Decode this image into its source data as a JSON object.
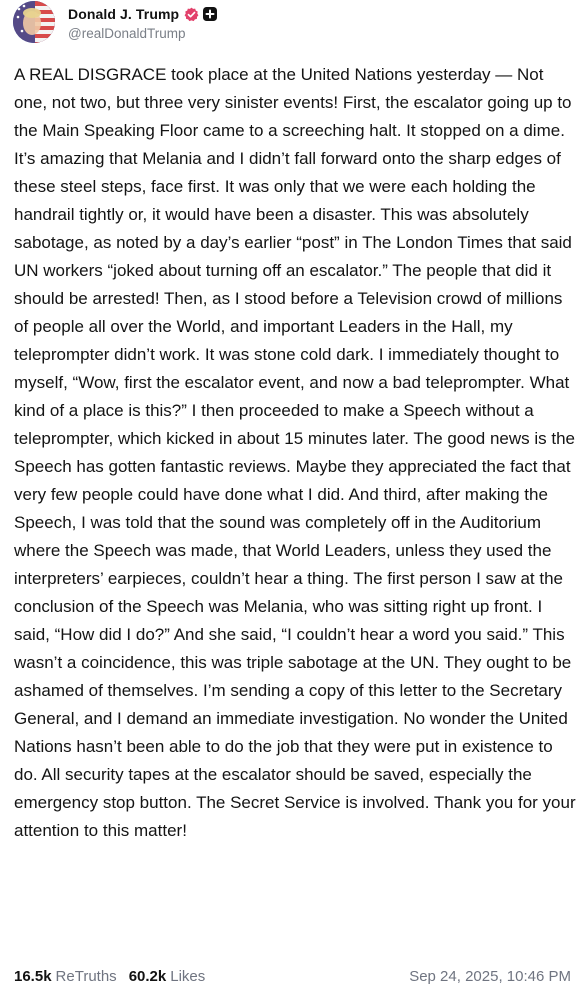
{
  "author": {
    "display_name": "Donald J. Trump",
    "handle": "@realDonaldTrump",
    "verified_icon": "verified-check-icon",
    "plus_icon": "plus-badge-icon",
    "accent_color": "#e2416b"
  },
  "post": {
    "text": "A REAL DISGRACE took place at the United Nations yesterday — Not one, not two, but three very sinister events! First, the escalator going up to the Main Speaking Floor came to a screeching halt. It stopped on a dime. It’s amazing that Melania and I didn’t fall forward onto the sharp edges of these steel steps, face first. It was only that we were each holding the handrail tightly or, it would have been a disaster. This was absolutely sabotage, as noted by a day’s earlier “post” in The London Times that said UN workers “joked about turning off an escalator.” The people that did it should be arrested! Then, as I stood before a Television crowd of millions of people all over the World, and important Leaders in the Hall, my teleprompter didn’t work. It was stone cold dark. I immediately thought to myself, “Wow, first the escalator event, and now a bad teleprompter. What kind of a place is this?” I then proceeded to make a Speech without a teleprompter, which kicked in about 15 minutes later. The good news is the Speech has gotten fantastic reviews. Maybe they appreciated the fact that very few people could have done what I did. And third, after making the Speech, I was told that the sound was completely off in the Auditorium where the Speech was made, that World Leaders, unless they used the interpreters’ earpieces, couldn’t hear a thing. The first person I saw at the conclusion of the Speech was Melania, who was sitting right up front. I said, “How did I do?” And she said, “I couldn’t hear a word you said.” This wasn’t a coincidence, this was triple sabotage at the UN. They ought to be ashamed of themselves. I’m sending a copy of this letter to the Secretary General, and I demand an immediate investigation. No wonder the United Nations hasn’t been able to do the job that they were put in existence to do. All security tapes at the escalator should be saved, especially the emergency stop button. The Secret Service is involved. Thank you for your attention to this matter!"
  },
  "stats": {
    "retruths_count": "16.5k",
    "retruths_label": "ReTruths",
    "likes_count": "60.2k",
    "likes_label": "Likes"
  },
  "timestamp": "Sep 24, 2025, 10:46 PM"
}
